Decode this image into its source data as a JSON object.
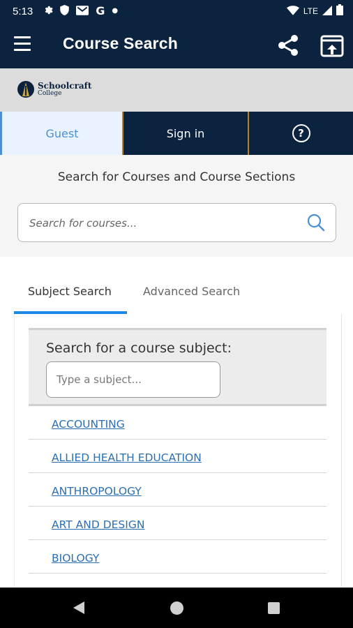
{
  "status_bar": {
    "time": "5:13",
    "network": "LTE",
    "icons": [
      "gear-icon",
      "shield-icon",
      "gmail-icon",
      "google-icon",
      "dot-icon",
      "wifi-icon",
      "signal-icon",
      "battery-icon"
    ]
  },
  "app_bar": {
    "title": "Course Search",
    "background_color": "#0c2340"
  },
  "logo": {
    "name": "Schoolcraft",
    "subtitle": "College"
  },
  "nav": {
    "guest": "Guest",
    "sign_in": "Sign in",
    "help_symbol": "?",
    "accent_color": "#b8860b"
  },
  "search": {
    "heading": "Search for Courses and Course Sections",
    "placeholder": "Search for courses..."
  },
  "tabs": {
    "subject": "Subject Search",
    "advanced": "Advanced Search",
    "active": "Subject Search"
  },
  "subject_search": {
    "label": "Search for a course subject:",
    "placeholder": "Type a subject..."
  },
  "subjects": [
    "ACCOUNTING",
    "ALLIED HEALTH EDUCATION",
    "ANTHROPOLOGY",
    "ART AND DESIGN",
    "BIOLOGY"
  ],
  "link_color": "#2a6fb5"
}
